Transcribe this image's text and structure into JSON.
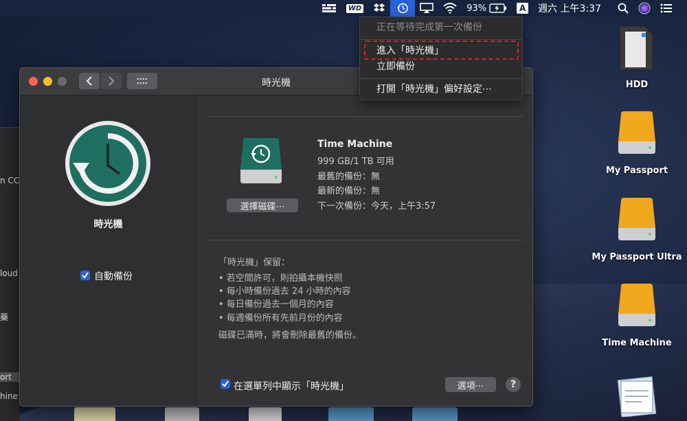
{
  "menubar": {
    "battery_percent": "93%",
    "input_source": "A",
    "clock": "週六 上午3:37",
    "wd_label": "WD",
    "icons": [
      "db-stack-icon",
      "wd-icon",
      "dropbox-icon",
      "time-machine-icon",
      "airplay-icon",
      "wifi-icon",
      "battery-icon",
      "input-source-icon",
      "spotlight-icon",
      "siri-icon",
      "list-icon"
    ]
  },
  "dropdown": {
    "status": "正在等待完成第一次備份",
    "enter": "進入「時光機」",
    "backup_now": "立即備份",
    "open_prefs": "打開「時光機」偏好設定⋯"
  },
  "window": {
    "title": "時光機",
    "app_name": "時光機",
    "auto_backup_label": "自動備份",
    "auto_backup_checked": true,
    "disk_name": "Time Machine",
    "disk_available": "999 GB/1 TB 可用",
    "oldest_backup": "最舊的備份：無",
    "latest_backup": "最新的備份：無",
    "next_backup": "下一次備份：今天，上午3:57",
    "select_disk_button": "選擇磁碟⋯",
    "keep_title": "「時光機」保留：",
    "keep_items": [
      "• 若空間許可，則拍攝本機快照",
      "• 每小時備份過去 24 小時的內容",
      "• 每日備份過去一個月的內容",
      "• 每週備份所有先前月份的內容"
    ],
    "full_note": "磁碟已滿時，將會刪除最舊的備份。",
    "show_in_menubar_label": "在選單列中顯示「時光機」",
    "show_in_menubar_checked": true,
    "options_button": "選項⋯",
    "help_button": "?"
  },
  "desktop": {
    "icons": [
      {
        "label": "HDD",
        "icon": "sd-card-icon"
      },
      {
        "label": "My Passport",
        "icon": "external-drive-icon"
      },
      {
        "label": "My Passport Ultra",
        "icon": "external-drive-icon"
      },
      {
        "label": "Time Machine",
        "icon": "external-drive-icon"
      }
    ]
  },
  "background_window": {
    "fragments": [
      "n CC",
      "loud",
      "藥",
      "ort",
      "hine"
    ]
  },
  "colors": {
    "accent": "#2a63d6",
    "highlight_border": "#e02020",
    "time_machine_green": "#1f6e62",
    "drive_orange": "#f2a81c"
  }
}
